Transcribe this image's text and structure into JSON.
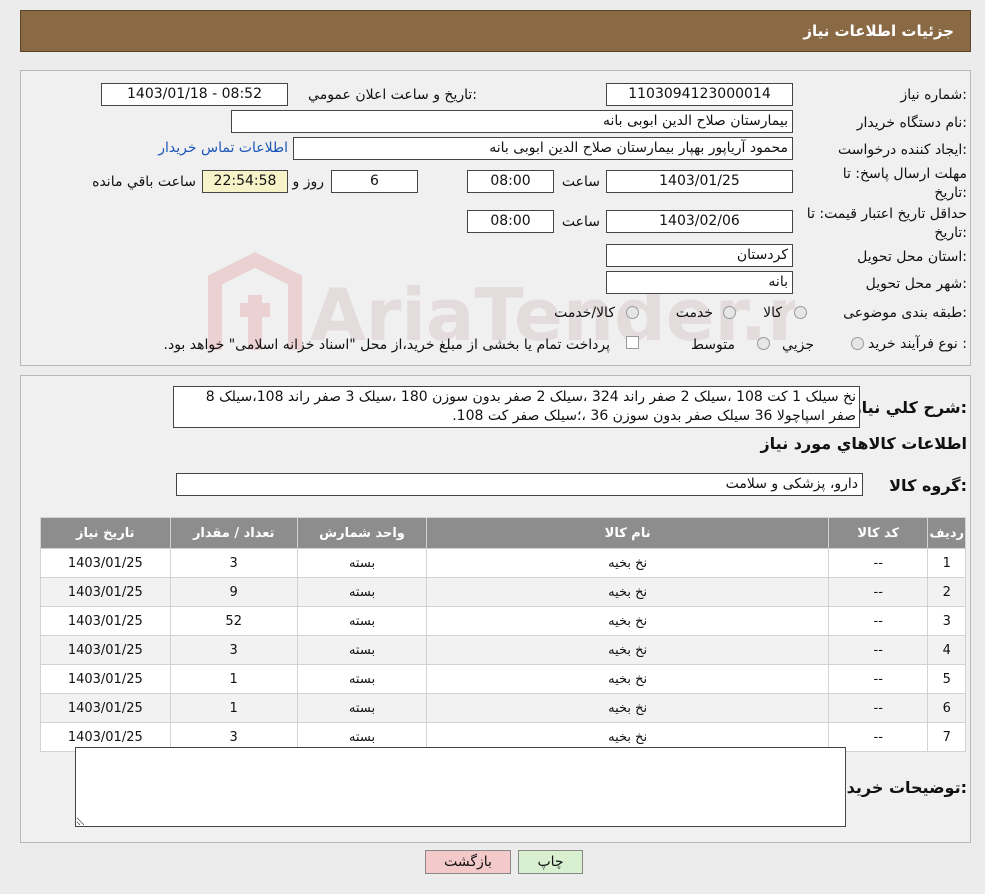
{
  "header": {
    "title": "جزئیات اطلاعات نیاز"
  },
  "form": {
    "need_number_label": "شماره نیاز:",
    "need_number": "1103094123000014",
    "announce_label": "تاریخ و ساعت اعلان عمومي:",
    "announce_value": "1403/01/18 - 08:52",
    "buyer_org_label": "نام دستگاه خریدار:",
    "buyer_org": "بیمارستان صلاح الدین ابوبی بانه",
    "creator_label": "ایجاد کننده درخواست:",
    "creator": "محمود آریاپور بهپار بیمارستان صلاح الدین ابوبی بانه",
    "contact_link": "اطلاعات تماس خریدار",
    "deadline_label_1": "مهلت ارسال پاسخ: تا",
    "deadline_label_2": "تاریخ:",
    "deadline_date": "1403/01/25",
    "time_label": "ساعت",
    "deadline_time": "08:00",
    "days_value": "6",
    "days_label": "روز و",
    "remaining_time": "22:54:58",
    "remaining_label": "ساعت باقي مانده",
    "validity_label_1": "حداقل تاریخ اعتبار قیمت: تا",
    "validity_label_2": "تاریخ:",
    "validity_date": "1403/02/06",
    "validity_time": "08:00",
    "province_label": "استان محل تحویل:",
    "province": "کردستان",
    "city_label": "شهر محل تحویل:",
    "city": "بانه",
    "category_label": "طبقه بندی موضوعی:",
    "category_options": [
      "کالا",
      "خدمت",
      "کالا/خدمت"
    ],
    "process_label": "نوع فرآیند خرید :",
    "process_options": [
      "جزیي",
      "متوسط"
    ],
    "payment_note": "پرداخت تمام یا بخشی از مبلغ خرید،از محل \"اسناد خزانه اسلامی\" خواهد بود."
  },
  "description": {
    "label": "شرح کلي نیاز:",
    "text": "نخ سیلک 1 کت 108 ،سیلک 2 صفر راند 324 ،سیلک 2 صفر بدون سوزن 180 ،سیلک 3 صفر راند 108،سیلک 8 صفر اسپاچولا 36 سیلک صفر بدون سوزن 36 ،؛سیلک صفر کت 108."
  },
  "goods": {
    "section_title": "اطلاعات کالاهاي مورد نیاز",
    "group_label": "گروه کالا:",
    "group_value": "دارو، پزشکی و سلامت",
    "columns": [
      "ردیف",
      "کد کالا",
      "نام کالا",
      "واحد شمارش",
      "تعداد / مقدار",
      "تاریخ نیاز"
    ],
    "rows": [
      [
        "1",
        "--",
        "نخ بخیه",
        "بسته",
        "3",
        "1403/01/25"
      ],
      [
        "2",
        "--",
        "نخ بخیه",
        "بسته",
        "9",
        "1403/01/25"
      ],
      [
        "3",
        "--",
        "نخ بخیه",
        "بسته",
        "52",
        "1403/01/25"
      ],
      [
        "4",
        "--",
        "نخ بخیه",
        "بسته",
        "3",
        "1403/01/25"
      ],
      [
        "5",
        "--",
        "نخ بخیه",
        "بسته",
        "1",
        "1403/01/25"
      ],
      [
        "6",
        "--",
        "نخ بخیه",
        "بسته",
        "1",
        "1403/01/25"
      ],
      [
        "7",
        "--",
        "نخ بخیه",
        "بسته",
        "3",
        "1403/01/25"
      ]
    ]
  },
  "notes": {
    "label": "توضیحات خریدار:",
    "value": ""
  },
  "buttons": {
    "print": "چاپ",
    "back": "بازگشت"
  },
  "watermark": {
    "text": "AriaTender.neT"
  },
  "colors": {
    "header": "#8a6a45",
    "table_header": "#8d8d8d",
    "link": "#1a57b8",
    "back_button": "#f4c9c9",
    "print_button": "#d8f0d0"
  }
}
